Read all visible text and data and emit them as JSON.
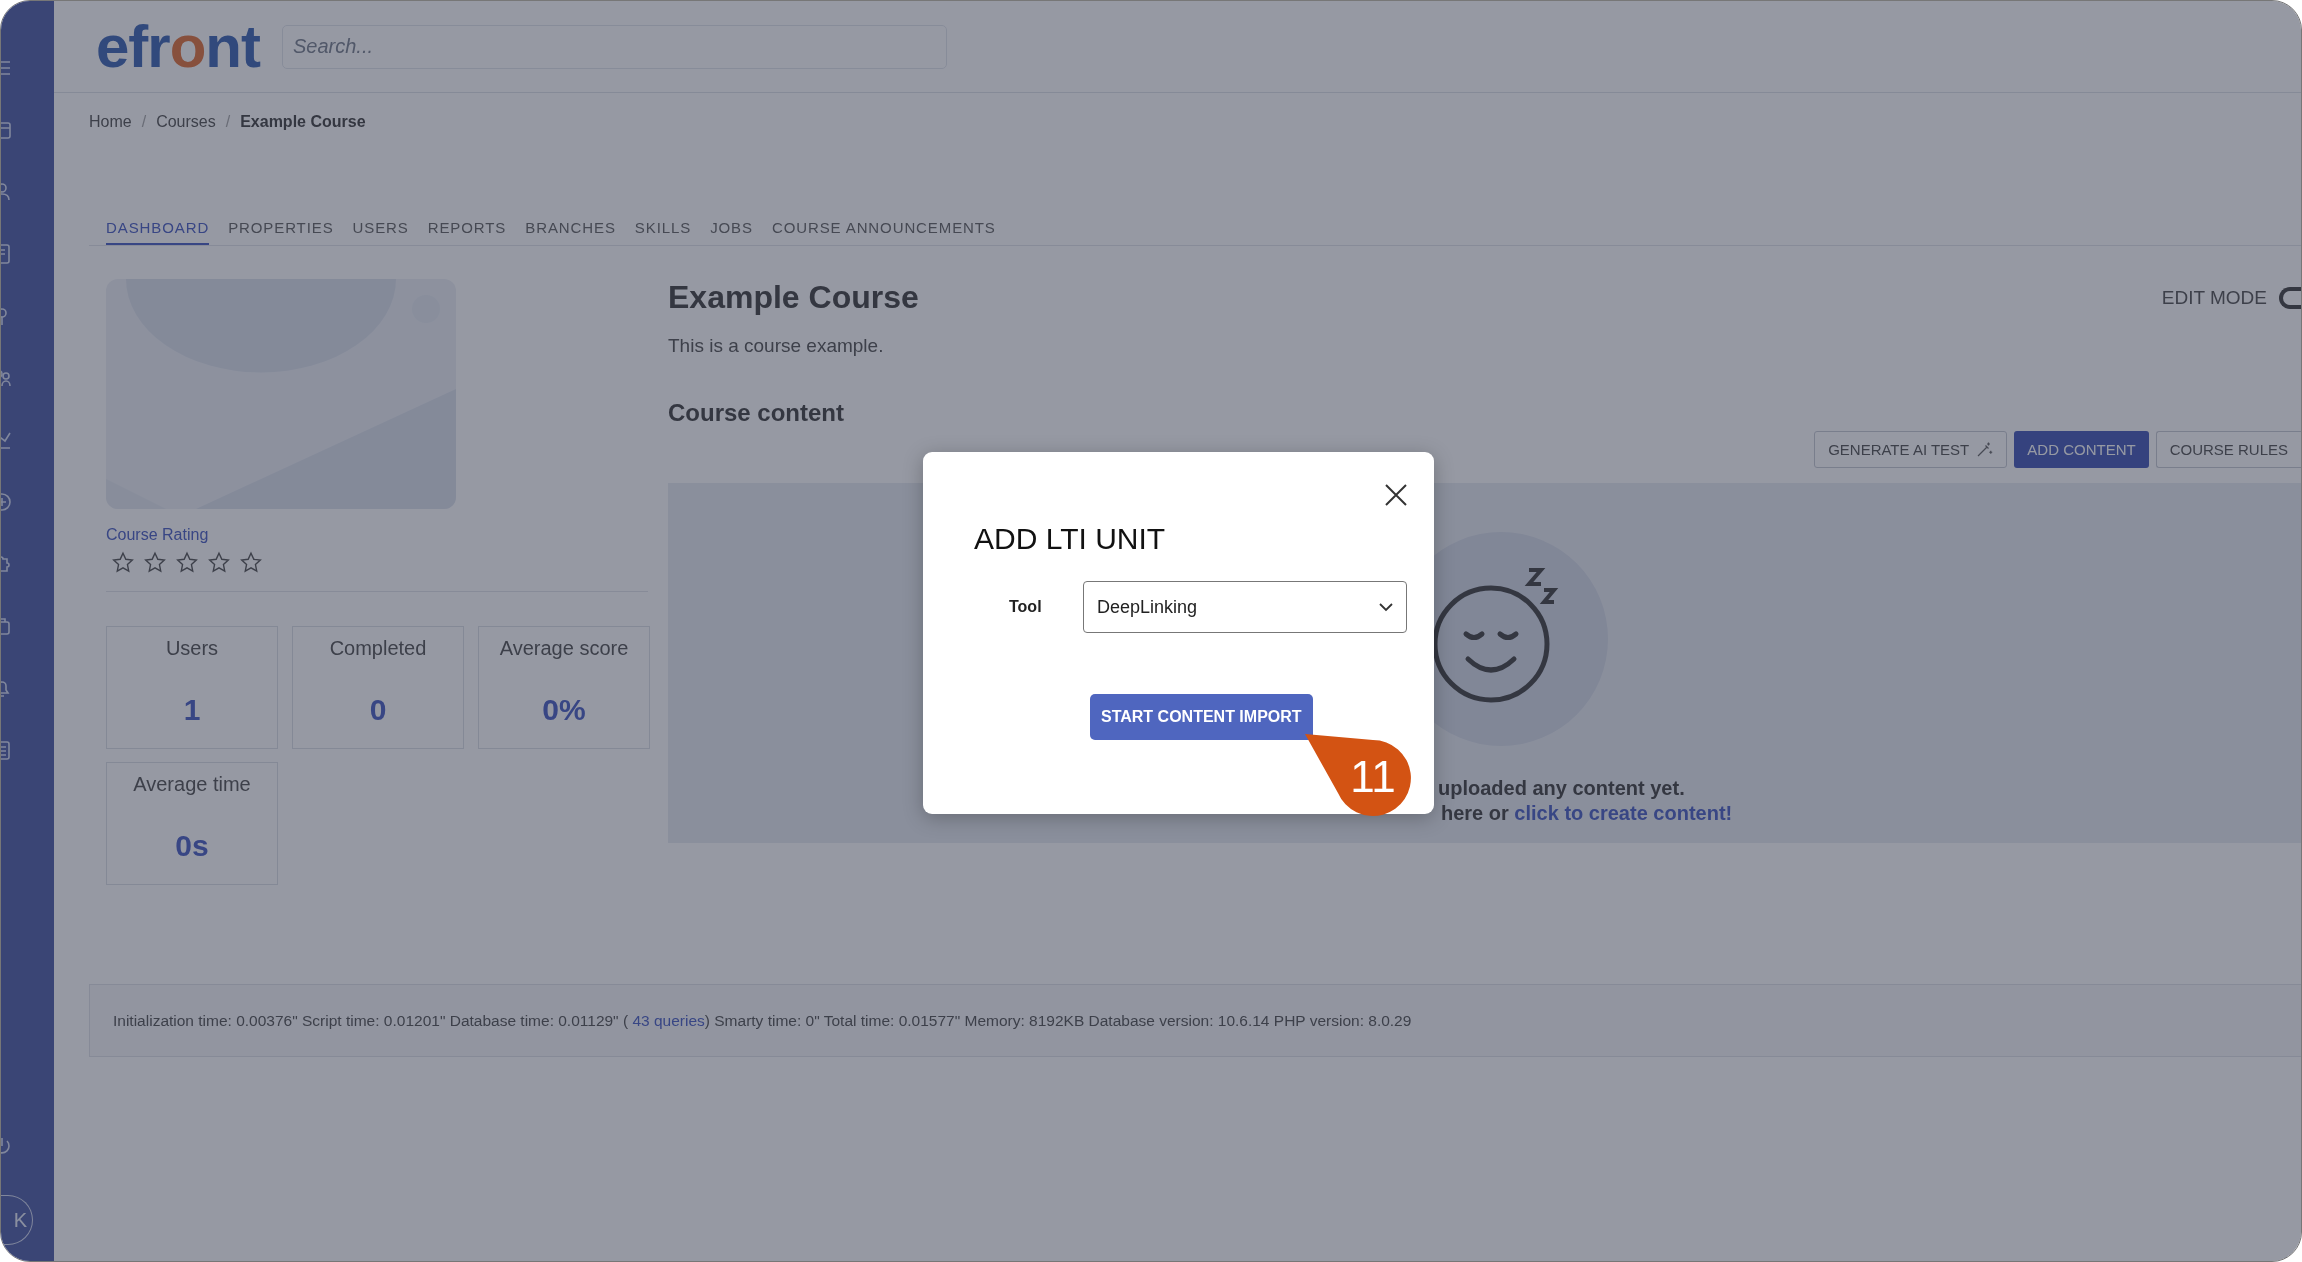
{
  "sidebar": {
    "icons": [
      {
        "kind": "menu"
      },
      {
        "kind": "calendar"
      },
      {
        "kind": "person"
      },
      {
        "kind": "book"
      },
      {
        "kind": "pin"
      },
      {
        "kind": "people"
      },
      {
        "kind": "chart"
      },
      {
        "kind": "plus"
      },
      {
        "kind": "puzzle"
      },
      {
        "kind": "bag"
      },
      {
        "kind": "bell"
      },
      {
        "kind": "list"
      }
    ],
    "power": {
      "kind": "power"
    },
    "avatar": "K"
  },
  "header": {
    "logo": "efront",
    "search": {
      "placeholder": "Search..."
    }
  },
  "breadcrumb": [
    "Home",
    "Courses",
    "Example Course"
  ],
  "breadcrumb_separator": "/",
  "tabs": [
    {
      "label": "DASHBOARD",
      "selected": true
    },
    {
      "label": "PROPERTIES",
      "selected": false
    },
    {
      "label": "USERS",
      "selected": false
    },
    {
      "label": "REPORTS",
      "selected": false
    },
    {
      "label": "BRANCHES",
      "selected": false
    },
    {
      "label": "SKILLS",
      "selected": false
    },
    {
      "label": "JOBS",
      "selected": false
    },
    {
      "label": "COURSE ANNOUNCEMENTS",
      "selected": false
    }
  ],
  "course": {
    "rating": {
      "label": "Course Rating",
      "stars": 0
    },
    "stats": [
      {
        "label": "Users",
        "value": "1"
      },
      {
        "label": "Completed",
        "value": "0"
      },
      {
        "label": "Average score",
        "value": "0%"
      },
      {
        "label": "Average time",
        "value": "0s"
      }
    ],
    "title": "Example Course",
    "description": "This is a course example.",
    "content_heading": "Course content"
  },
  "edit_mode": {
    "label": "EDIT MODE",
    "on": false
  },
  "actions": [
    {
      "label": "GENERATE AI TEST",
      "kind": "generate"
    },
    {
      "label": "ADD CONTENT",
      "kind": "primary"
    },
    {
      "label": "COURSE RULES",
      "kind": "outline"
    }
  ],
  "empty_state": {
    "line_1": "uploaded any content yet.",
    "line_2": "here or ",
    "link": "click to create content!"
  },
  "footer": {
    "before": "Initialization time: 0.00376\" Script time: 0.01201\" Database time: 0.01129\" ( ",
    "link": "43 queries",
    "after": ") Smarty time: 0\" Total time: 0.01577\" Memory: 8192KB Database version: 10.6.14 PHP version: 8.0.29"
  },
  "modal": {
    "title": "ADD LTI UNIT",
    "field_label": "Tool",
    "field_value": "DeepLinking",
    "button": "START CONTENT IMPORT"
  },
  "callout": {
    "label": "11"
  }
}
